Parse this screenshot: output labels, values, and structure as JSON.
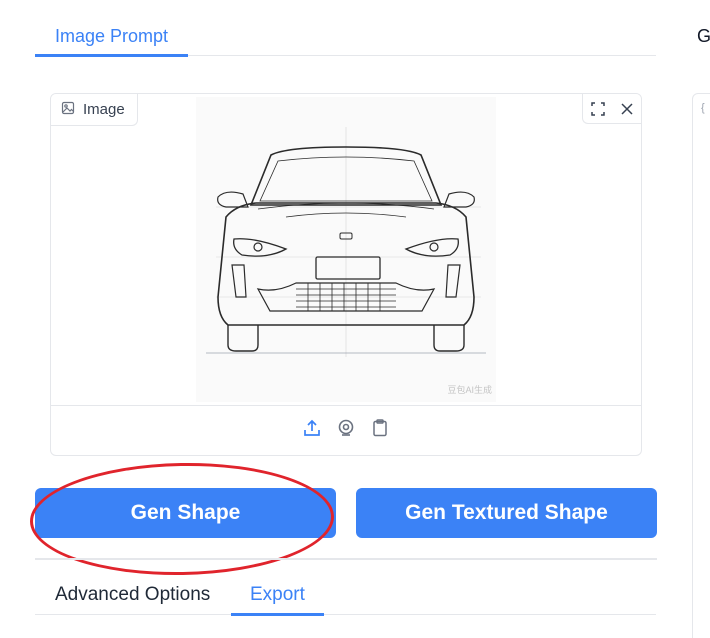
{
  "tabs": {
    "image_prompt": "Image Prompt",
    "right_partial": "G"
  },
  "right_panel": {
    "glyph": "{"
  },
  "image_card": {
    "label": "Image",
    "label_icon": "image-icon",
    "tools": [
      "fullscreen-icon",
      "close-icon"
    ],
    "footer_icons": [
      "upload-icon",
      "webcam-icon",
      "clipboard-icon"
    ],
    "watermark": "豆包AI生成"
  },
  "buttons": {
    "gen_shape": "Gen Shape",
    "gen_textured_shape": "Gen Textured Shape"
  },
  "bottom_tabs": {
    "advanced_options": "Advanced Options",
    "export": "Export"
  },
  "colors": {
    "accent": "#3b82f6",
    "annotation": "#e0242c"
  }
}
